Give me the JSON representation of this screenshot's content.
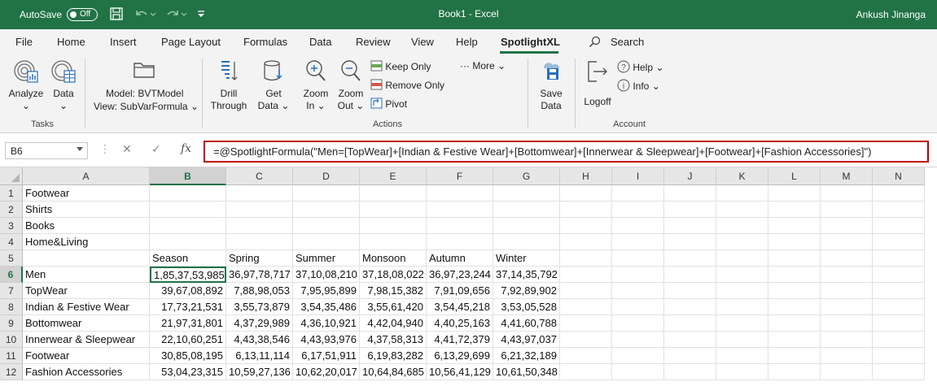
{
  "titlebar": {
    "autosave_label": "AutoSave",
    "autosave_state": "Off",
    "title": "Book1  -  Excel",
    "user": "Ankush Jinanga"
  },
  "menu": {
    "tabs": [
      "File",
      "Home",
      "Insert",
      "Page Layout",
      "Formulas",
      "Data",
      "Review",
      "View",
      "Help",
      "SpotlightXL"
    ],
    "active": "SpotlightXL",
    "search_label": "Search"
  },
  "ribbon": {
    "analyze": "Analyze",
    "data": "Data",
    "model": "Model: BVTModel",
    "view": "View: SubVarFormula",
    "drill1": "Drill",
    "drill2": "Through",
    "get1": "Get",
    "get2": "Data",
    "zoomin1": "Zoom",
    "zoomin2": "In",
    "zoomout1": "Zoom",
    "zoomout2": "Out",
    "keep_only": "Keep Only",
    "remove_only": "Remove Only",
    "pivot": "Pivot",
    "more": "More",
    "save1": "Save",
    "save2": "Data",
    "logoff": "Logoff",
    "help": "Help",
    "info": "Info",
    "groups": {
      "tasks": "Tasks",
      "actions": "Actions",
      "account": "Account"
    }
  },
  "formula_bar": {
    "name_box": "B6",
    "formula": "=@SpotlightFormula(\"Men=[TopWear]+[Indian & Festive Wear]+[Bottomwear]+[Innerwear & Sleepwear]+[Footwear]+[Fashion Accessories]\")"
  },
  "grid": {
    "columns": [
      "A",
      "B",
      "C",
      "D",
      "E",
      "F",
      "G",
      "H",
      "I",
      "J",
      "K",
      "L",
      "M",
      "N"
    ],
    "selected_column": "B",
    "selected_row": "6",
    "rows": [
      {
        "n": "1",
        "cells": [
          "Footwear",
          "",
          "",
          "",
          "",
          "",
          ""
        ]
      },
      {
        "n": "2",
        "cells": [
          "Shirts",
          "",
          "",
          "",
          "",
          "",
          ""
        ]
      },
      {
        "n": "3",
        "cells": [
          "Books",
          "",
          "",
          "",
          "",
          "",
          ""
        ]
      },
      {
        "n": "4",
        "cells": [
          "Home&Living",
          "",
          "",
          "",
          "",
          "",
          ""
        ]
      },
      {
        "n": "5",
        "cells": [
          "",
          "Season",
          "Spring",
          "Summer",
          "Monsoon",
          "Autumn",
          "Winter"
        ]
      },
      {
        "n": "6",
        "cells": [
          "Men",
          "1,85,37,53,985",
          "36,97,78,717",
          "37,10,08,210",
          "37,18,08,022",
          "36,97,23,244",
          "37,14,35,792"
        ]
      },
      {
        "n": "7",
        "cells": [
          "TopWear",
          "39,67,08,892",
          "7,88,98,053",
          "7,95,95,899",
          "7,98,15,382",
          "7,91,09,656",
          "7,92,89,902"
        ]
      },
      {
        "n": "8",
        "cells": [
          "Indian & Festive Wear",
          "17,73,21,531",
          "3,55,73,879",
          "3,54,35,486",
          "3,55,61,420",
          "3,54,45,218",
          "3,53,05,528"
        ]
      },
      {
        "n": "9",
        "cells": [
          "Bottomwear",
          "21,97,31,801",
          "4,37,29,989",
          "4,36,10,921",
          "4,42,04,940",
          "4,40,25,163",
          "4,41,60,788"
        ]
      },
      {
        "n": "10",
        "cells": [
          "Innerwear & Sleepwear",
          "22,10,60,251",
          "4,43,38,546",
          "4,43,93,976",
          "4,37,58,313",
          "4,41,72,379",
          "4,43,97,037"
        ]
      },
      {
        "n": "11",
        "cells": [
          "Footwear",
          "30,85,08,195",
          "6,13,11,114",
          "6,17,51,911",
          "6,19,83,282",
          "6,13,29,699",
          "6,21,32,189"
        ]
      },
      {
        "n": "12",
        "cells": [
          "Fashion Accessories",
          "53,04,23,315",
          "10,59,27,136",
          "10,62,20,017",
          "10,64,84,685",
          "10,56,41,129",
          "10,61,50,348"
        ]
      }
    ]
  }
}
